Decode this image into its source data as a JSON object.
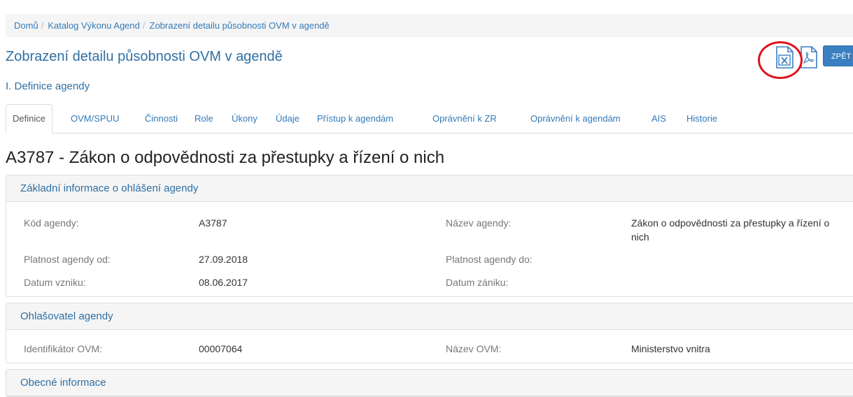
{
  "breadcrumb": {
    "items": [
      "Domů",
      "Katalog Výkonu Agend",
      "Zobrazení detailu působnosti OVM v agendě"
    ],
    "separator": "/"
  },
  "page_title": "Zobrazení detailu působnosti OVM v agendě",
  "section_title": "I. Definice agendy",
  "toolbar": {
    "excel_icon": "excel-export-icon",
    "pdf_icon": "pdf-export-icon",
    "back_label": "ZPĚT",
    "accent_color": "#3a7fc1",
    "highlight_color": "#e0141c"
  },
  "tabs": [
    {
      "label": "Definice",
      "active": true
    },
    {
      "label": "OVM/SPUU"
    },
    {
      "label": "Činnosti"
    },
    {
      "label": "Role"
    },
    {
      "label": "Úkony"
    },
    {
      "label": "Údaje"
    },
    {
      "label": "Přístup k agendám"
    },
    {
      "label": "Oprávnění k ZR"
    },
    {
      "label": "Oprávnění k agendám"
    },
    {
      "label": "AIS"
    },
    {
      "label": "Historie"
    }
  ],
  "record_title": "A3787 - Zákon o odpovědnosti za přestupky a řízení o nich",
  "panels": {
    "basic": {
      "heading": "Základní informace o ohlášení agendy",
      "code_label": "Kód agendy:",
      "code_value": "A3787",
      "name_label": "Název agendy:",
      "name_value_line1": "Zákon o odpovědnosti za přestupky a řízení o",
      "name_value_line2": "nich",
      "valid_from_label": "Platnost agendy od:",
      "valid_from_value": "27.09.2018",
      "valid_to_label": "Platnost agendy do:",
      "valid_to_value": "",
      "created_label": "Datum vzniku:",
      "created_value": "08.06.2017",
      "ended_label": "Datum zániku:",
      "ended_value": ""
    },
    "announcer": {
      "heading": "Ohlašovatel agendy",
      "id_label": "Identifikátor OVM:",
      "id_value": "00007064",
      "name_label": "Název OVM:",
      "name_value": "Ministerstvo vnitra"
    },
    "general": {
      "heading": "Obecné informace"
    }
  }
}
